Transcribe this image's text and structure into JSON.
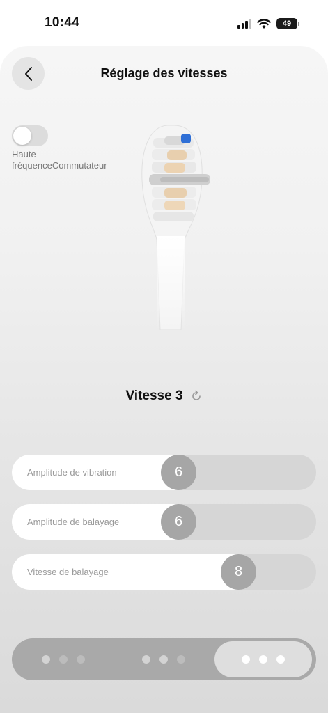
{
  "status_bar": {
    "time": "10:44",
    "battery": "49"
  },
  "header": {
    "title": "Réglage des vitesses",
    "back_icon": "chevron-left-icon"
  },
  "toggle": {
    "label": "Haute fréquenceCommutateur",
    "on": false
  },
  "speed": {
    "label": "Vitesse 3",
    "reset_icon": "refresh-icon"
  },
  "sliders": [
    {
      "label": "Amplitude de vibration",
      "value": "6",
      "fill_fraction": 0.6
    },
    {
      "label": "Amplitude de balayage",
      "value": "6",
      "fill_fraction": 0.6
    },
    {
      "label": "Vitesse de balayage",
      "value": "8",
      "fill_fraction": 0.8
    }
  ],
  "modes": {
    "count": 3,
    "selected_index": 2
  },
  "colors": {
    "accent_blue": "#2f6fd6",
    "thumb_gray": "#a6a6a6"
  }
}
